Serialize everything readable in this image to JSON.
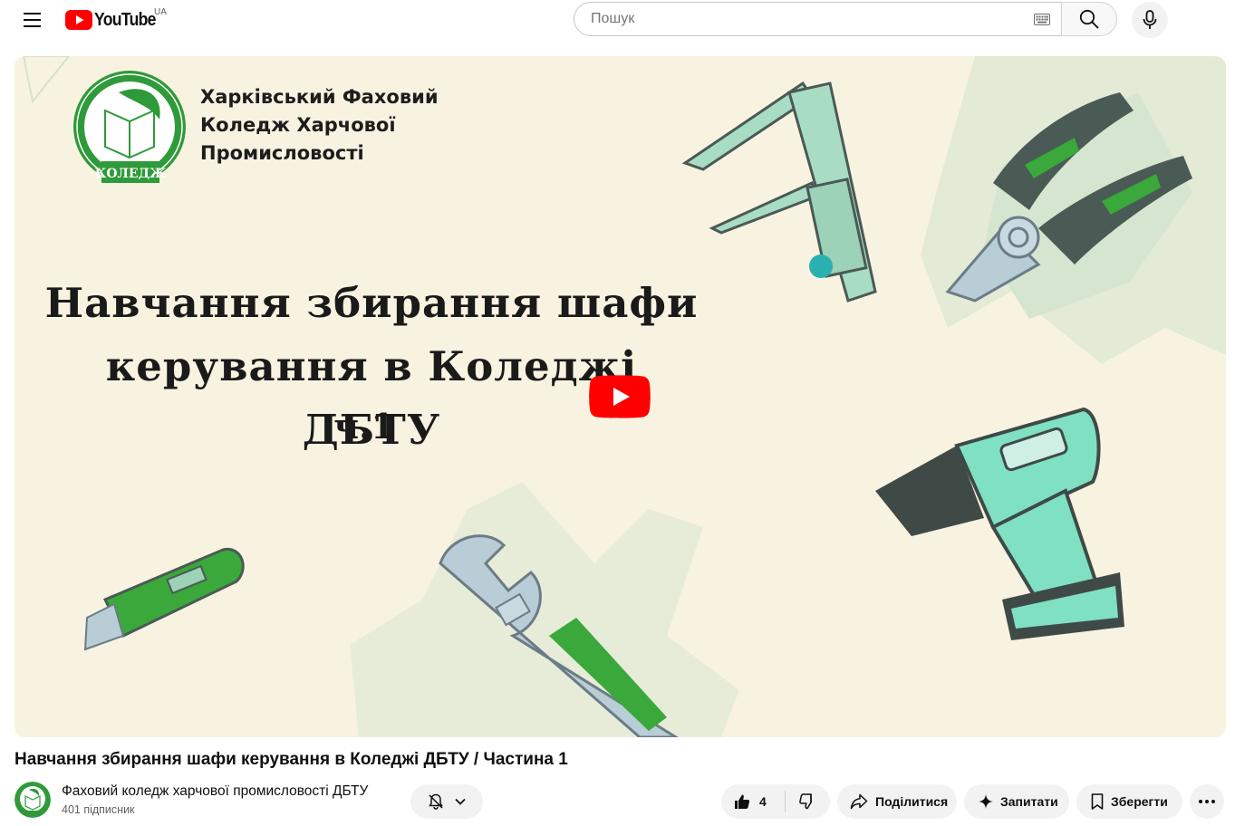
{
  "masthead": {
    "logo_text": "YouTube",
    "country_code": "UA",
    "search_placeholder": "Пошук"
  },
  "player": {
    "college_name": "Харківський Фаховий\nКоледж Харчової\nПромисловості",
    "logo_badge": "КОЛЕДЖ",
    "thumbnail_title": "Навчання збирання шафи\nкерування в Коледжі ДБТУ",
    "thumbnail_subtitle": "ч.1"
  },
  "video": {
    "title": "Навчання збирання шафи керування в Коледжі ДБТУ / Частина 1"
  },
  "channel": {
    "name": "Фаховий коледж харчової промисловості ДБТУ",
    "subscribers": "401 підписник"
  },
  "actions": {
    "like_count": "4",
    "share_label": "Поділитися",
    "ask_label": "Запитати",
    "save_label": "Зберегти"
  },
  "colors": {
    "brand_red": "#ff0000",
    "thumbnail_bg": "#f8f3e1",
    "accent_green": "#3aa83a",
    "mint": "#7fe0c2"
  },
  "icons": [
    "menu-icon",
    "youtube-logo-icon",
    "keyboard-icon",
    "search-icon",
    "mic-icon",
    "play-icon",
    "bell-off-icon",
    "chevron-down-icon",
    "thumb-up-icon",
    "thumb-down-icon",
    "share-icon",
    "sparkle-icon",
    "bookmark-icon",
    "more-icon"
  ]
}
